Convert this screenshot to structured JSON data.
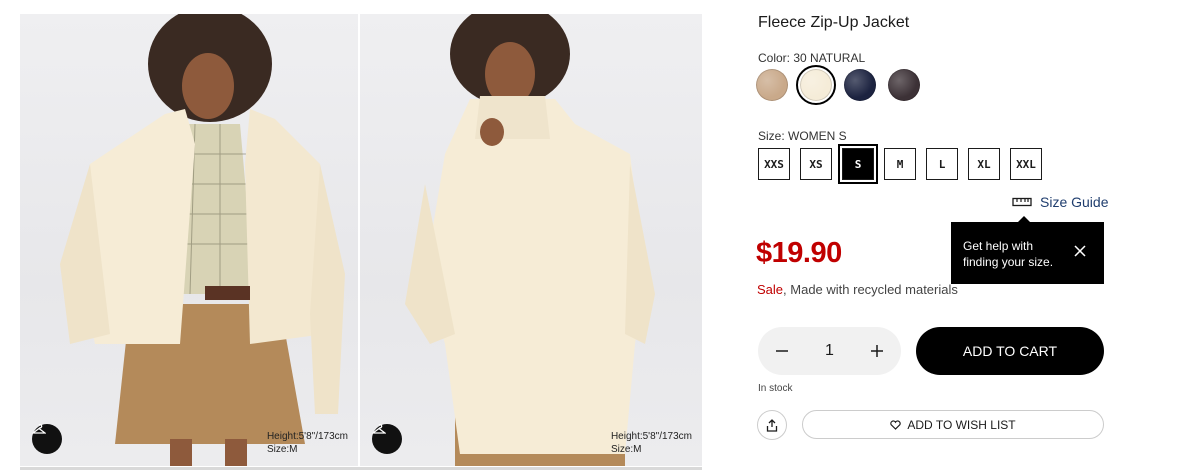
{
  "product": {
    "title": "Fleece Zip-Up Jacket",
    "color_label": "Color: 30 NATURAL",
    "size_label": "Size: WOMEN S",
    "price": "$19.90",
    "sale_text": "Sale",
    "sale_note": ",  Made with recycled materials",
    "stock": "In stock"
  },
  "swatches": [
    {
      "name": "beige",
      "color": "#c9a98a",
      "selected": false
    },
    {
      "name": "natural",
      "color": "#f5ecd8",
      "selected": true
    },
    {
      "name": "navy",
      "color": "#1c2340",
      "selected": false
    },
    {
      "name": "dark-brown",
      "color": "#3c3136",
      "selected": false
    }
  ],
  "sizes": [
    {
      "label": "XXS",
      "selected": false
    },
    {
      "label": "XS",
      "selected": false
    },
    {
      "label": "S",
      "selected": true
    },
    {
      "label": "M",
      "selected": false
    },
    {
      "label": "L",
      "selected": false
    },
    {
      "label": "XL",
      "selected": false
    },
    {
      "label": "XXL",
      "selected": false
    }
  ],
  "size_guide": {
    "label": "Size Guide",
    "icon": "ruler-icon"
  },
  "tooltip": {
    "line1": "Get help with",
    "line2": "finding your size."
  },
  "quantity": {
    "value": "1"
  },
  "buttons": {
    "add_to_cart": "ADD TO CART",
    "wishlist": "ADD TO WISH LIST"
  },
  "gallery": [
    {
      "height": "Height:5'8\"/173cm",
      "size": "Size:M"
    },
    {
      "height": "Height:5'8\"/173cm",
      "size": "Size:M"
    }
  ],
  "colors": {
    "price": "#c00000",
    "link": "#1f3d6e",
    "primary": "#000000"
  }
}
